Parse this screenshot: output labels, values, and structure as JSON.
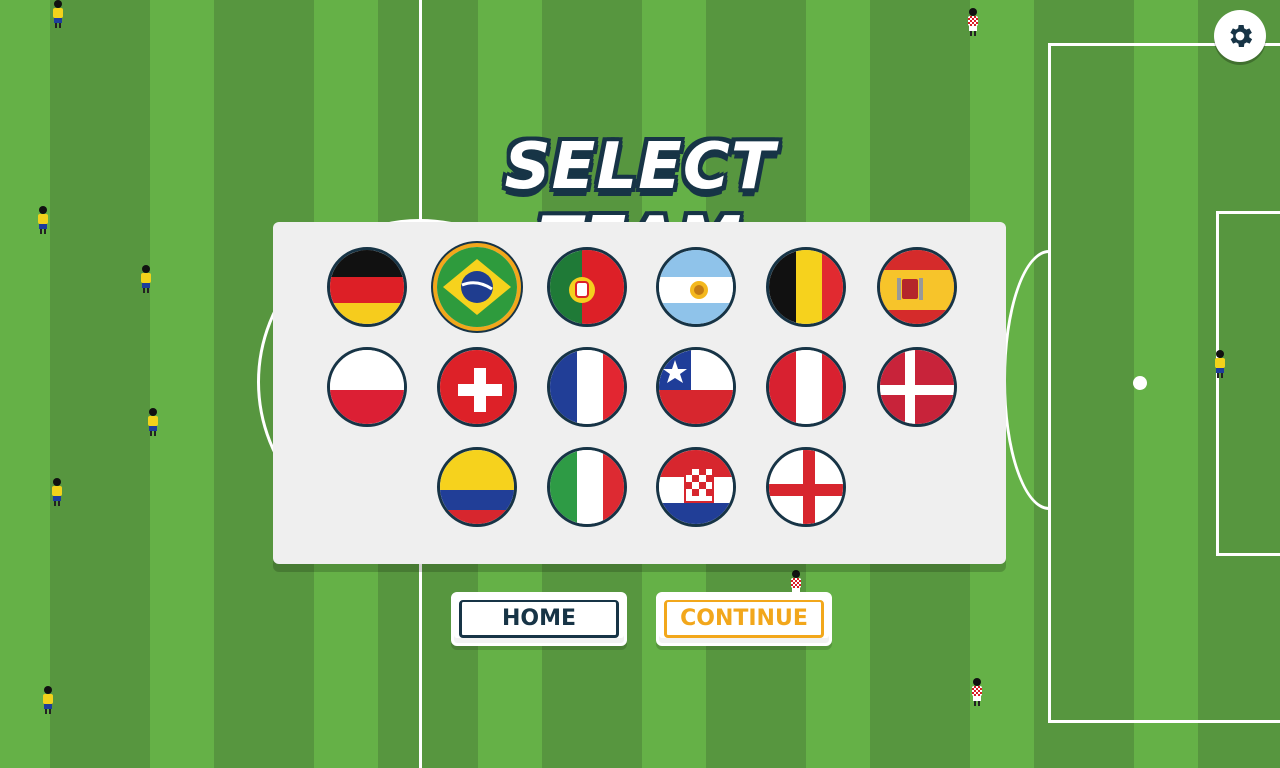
{
  "title": "SELECT TEAM",
  "buttons": {
    "home": "HOME",
    "continue": "CONTINUE"
  },
  "settings": {
    "icon": "gear-icon"
  },
  "colors": {
    "accent_selected": "#f2a71b",
    "outline": "#173446",
    "pitch_light": "#65b147",
    "pitch_dark": "#57963f"
  },
  "teams": [
    {
      "flag": "germany",
      "selected": false
    },
    {
      "flag": "brazil",
      "selected": true
    },
    {
      "flag": "portugal",
      "selected": false
    },
    {
      "flag": "argentina",
      "selected": false
    },
    {
      "flag": "belgium",
      "selected": false
    },
    {
      "flag": "spain",
      "selected": false
    },
    {
      "flag": "poland",
      "selected": false
    },
    {
      "flag": "switzerland",
      "selected": false
    },
    {
      "flag": "france",
      "selected": false
    },
    {
      "flag": "chile",
      "selected": false
    },
    {
      "flag": "peru",
      "selected": false
    },
    {
      "flag": "denmark",
      "selected": false
    },
    {
      "flag": "colombia",
      "selected": false
    },
    {
      "flag": "italy",
      "selected": false
    },
    {
      "flag": "croatia",
      "selected": false
    },
    {
      "flag": "england",
      "selected": false
    }
  ]
}
